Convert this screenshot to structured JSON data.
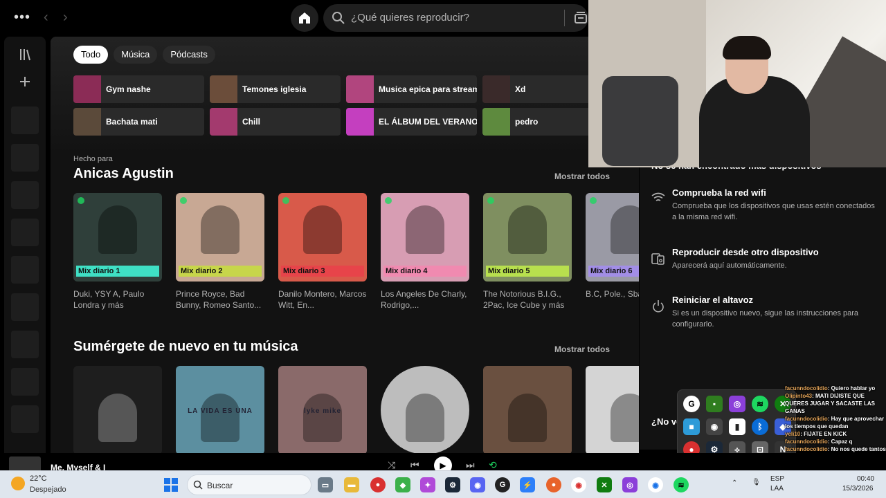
{
  "topbar": {
    "menu_glyph": "•••",
    "back_glyph": "‹",
    "forward_glyph": "›",
    "search_placeholder": "¿Qué quieres reproducir?"
  },
  "filters": [
    "Todo",
    "Música",
    "Pódcasts"
  ],
  "quick_access": [
    {
      "label": "Gym nashe",
      "color": "#8b2c56"
    },
    {
      "label": "Temones iglesia",
      "color": "#6b4d3a"
    },
    {
      "label": "Musica epica para stream",
      "color": "#b1457e"
    },
    {
      "label": "Xd",
      "color": "#3a2a2a"
    },
    {
      "label": "Bachata mati",
      "color": "#5b4a3a"
    },
    {
      "label": "Chill",
      "color": "#a33a6e"
    },
    {
      "label": "EL ÁLBUM DEL VERANO",
      "color": "#c43fbf"
    },
    {
      "label": "pedro",
      "color": "#5e8a3e"
    }
  ],
  "made_for": {
    "kicker": "Hecho para",
    "title": "Anicas Agustin",
    "more": "Mostrar todos",
    "cards": [
      {
        "badge": "Mix diario 1",
        "subtitle": "Duki, YSY A, Paulo Londra y más",
        "cover": "#2f3f3a",
        "bar": "#3fe0c5"
      },
      {
        "badge": "Mix diario 2",
        "subtitle": "Prince Royce, Bad Bunny, Romeo Santo...",
        "cover": "#c8a894",
        "bar": "#c7d64a"
      },
      {
        "badge": "Mix diario 3",
        "subtitle": "Danilo Montero, Marcos Witt, En...",
        "cover": "#d85a4a",
        "bar": "#e7444a"
      },
      {
        "badge": "Mix diario 4",
        "subtitle": "Los Angeles De Charly, Rodrigo,...",
        "cover": "#d79db3",
        "bar": "#f08ab0"
      },
      {
        "badge": "Mix diario 5",
        "subtitle": "The Notorious B.I.G., 2Pac, Ice Cube y más",
        "cover": "#7f8f60",
        "bar": "#b8e04e"
      },
      {
        "badge": "Mix diario 6",
        "subtitle": "B.C, Pole., Sba",
        "cover": "#9a9aa5",
        "bar": "#a28ee6"
      }
    ]
  },
  "dive_back": {
    "title": "Sumérgete de nuevo en tu música",
    "more": "Mostrar todos",
    "covers": [
      {
        "color": "#1e1e1e",
        "text": ""
      },
      {
        "color": "#5c8fa0",
        "text": "LA VIDA ES UNA"
      },
      {
        "color": "#8a6a6a",
        "text": "lyke mike"
      },
      {
        "color": "#bdbdbd",
        "text": ""
      },
      {
        "color": "#6a5040",
        "text": ""
      },
      {
        "color": "#d4d4d4",
        "text": ""
      }
    ]
  },
  "devices": {
    "header": "No se han encontrado más dispositivos",
    "items": [
      {
        "title": "Comprueba la red wifi",
        "desc": "Comprueba que los dispositivos que usas estén conectados a la misma red wifi."
      },
      {
        "title": "Reproducir desde otro dispositivo",
        "desc": "Aparecerá aquí automáticamente."
      },
      {
        "title": "Reiniciar el altavoz",
        "desc": "Si es un dispositivo nuevo, sigue las instrucciones para configurarlo."
      }
    ],
    "footer": "¿No ve"
  },
  "chat": [
    {
      "user": "facunndocolidio",
      "msg": ": Quiero hablar yo"
    },
    {
      "user": "Olipinto43",
      "msg": ": MATI DIJISTE QUE QUERES JUGAR Y SACASTE LAS GANAS"
    },
    {
      "user": "facunndocolidio",
      "msg": ": Hay que aprovechar los tiempos que quedan"
    },
    {
      "user": "yeli10",
      "msg": ": FIJATE EN KICK"
    },
    {
      "user": "facunndocolidio",
      "msg": ": Capaz q"
    },
    {
      "user": "facunndocolidio",
      "msg": ": No nos quede tantos tiempo"
    }
  ],
  "player": {
    "track": "Me, Myself & I"
  },
  "taskbar": {
    "temp": "22°C",
    "weather": "Despejado",
    "search": "Buscar",
    "lang": "ESP",
    "lang2": "LAA",
    "time": "00:40",
    "date": "15/3/2026"
  },
  "colors": {
    "spotify_green": "#1ed760",
    "panel_bg": "#121212"
  }
}
